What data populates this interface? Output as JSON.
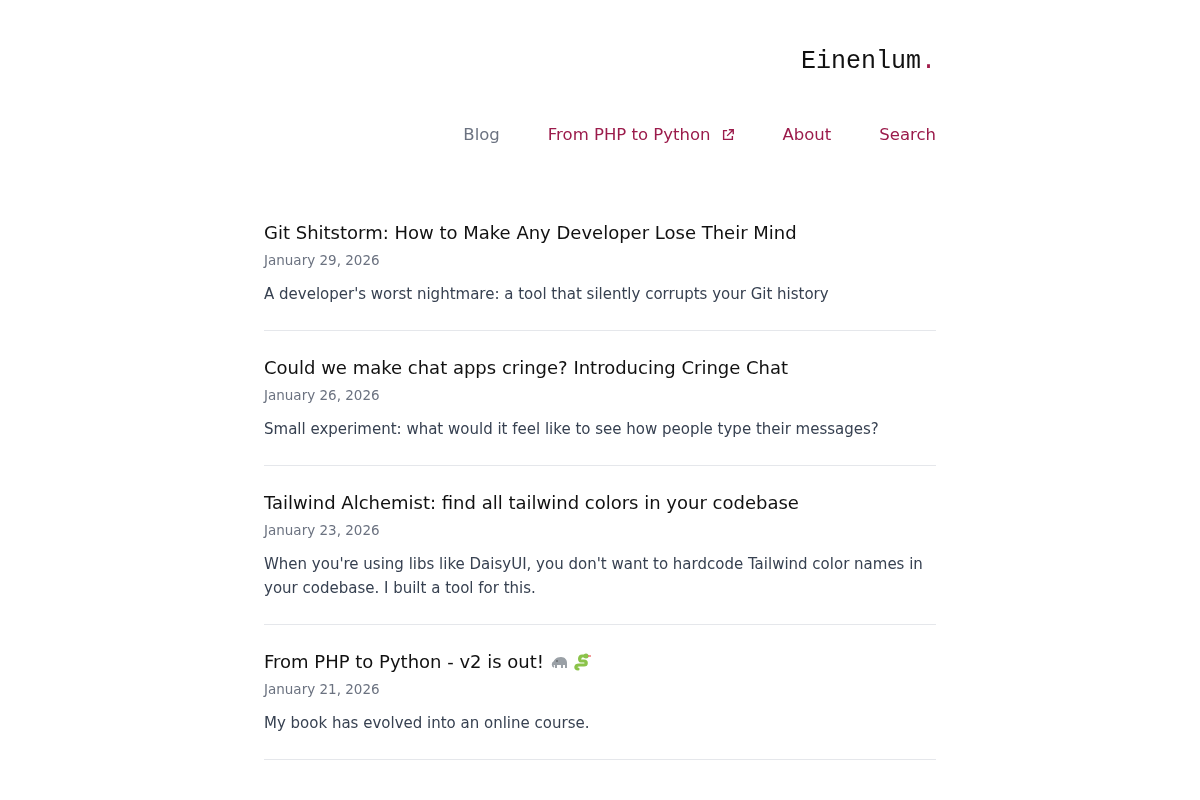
{
  "logo": {
    "text": "Einenlum",
    "dot": "."
  },
  "nav": [
    {
      "label": "Blog",
      "selected": true,
      "external": false
    },
    {
      "label": "From PHP to Python",
      "selected": false,
      "external": true
    },
    {
      "label": "About",
      "selected": false,
      "external": false
    },
    {
      "label": "Search",
      "selected": false,
      "external": false
    }
  ],
  "posts": [
    {
      "title": "Git Shitstorm: How to Make Any Developer Lose Their Mind",
      "date": "January 29, 2026",
      "summary": "A developer's worst nightmare: a tool that silently corrupts your Git history"
    },
    {
      "title": "Could we make chat apps cringe? Introducing Cringe Chat",
      "date": "January 26, 2026",
      "summary": "Small experiment: what would it feel like to see how people type their messages?"
    },
    {
      "title": "Tailwind Alchemist: find all tailwind colors in your codebase",
      "date": "January 23, 2026",
      "summary": "When you're using libs like DaisyUI, you don't want to hardcode Tailwind color names in your codebase. I built a tool for this."
    },
    {
      "title": "From PHP to Python - v2 is out!",
      "date": "January 21, 2026",
      "summary": "My book has evolved into an online course.",
      "emoji": true
    }
  ]
}
